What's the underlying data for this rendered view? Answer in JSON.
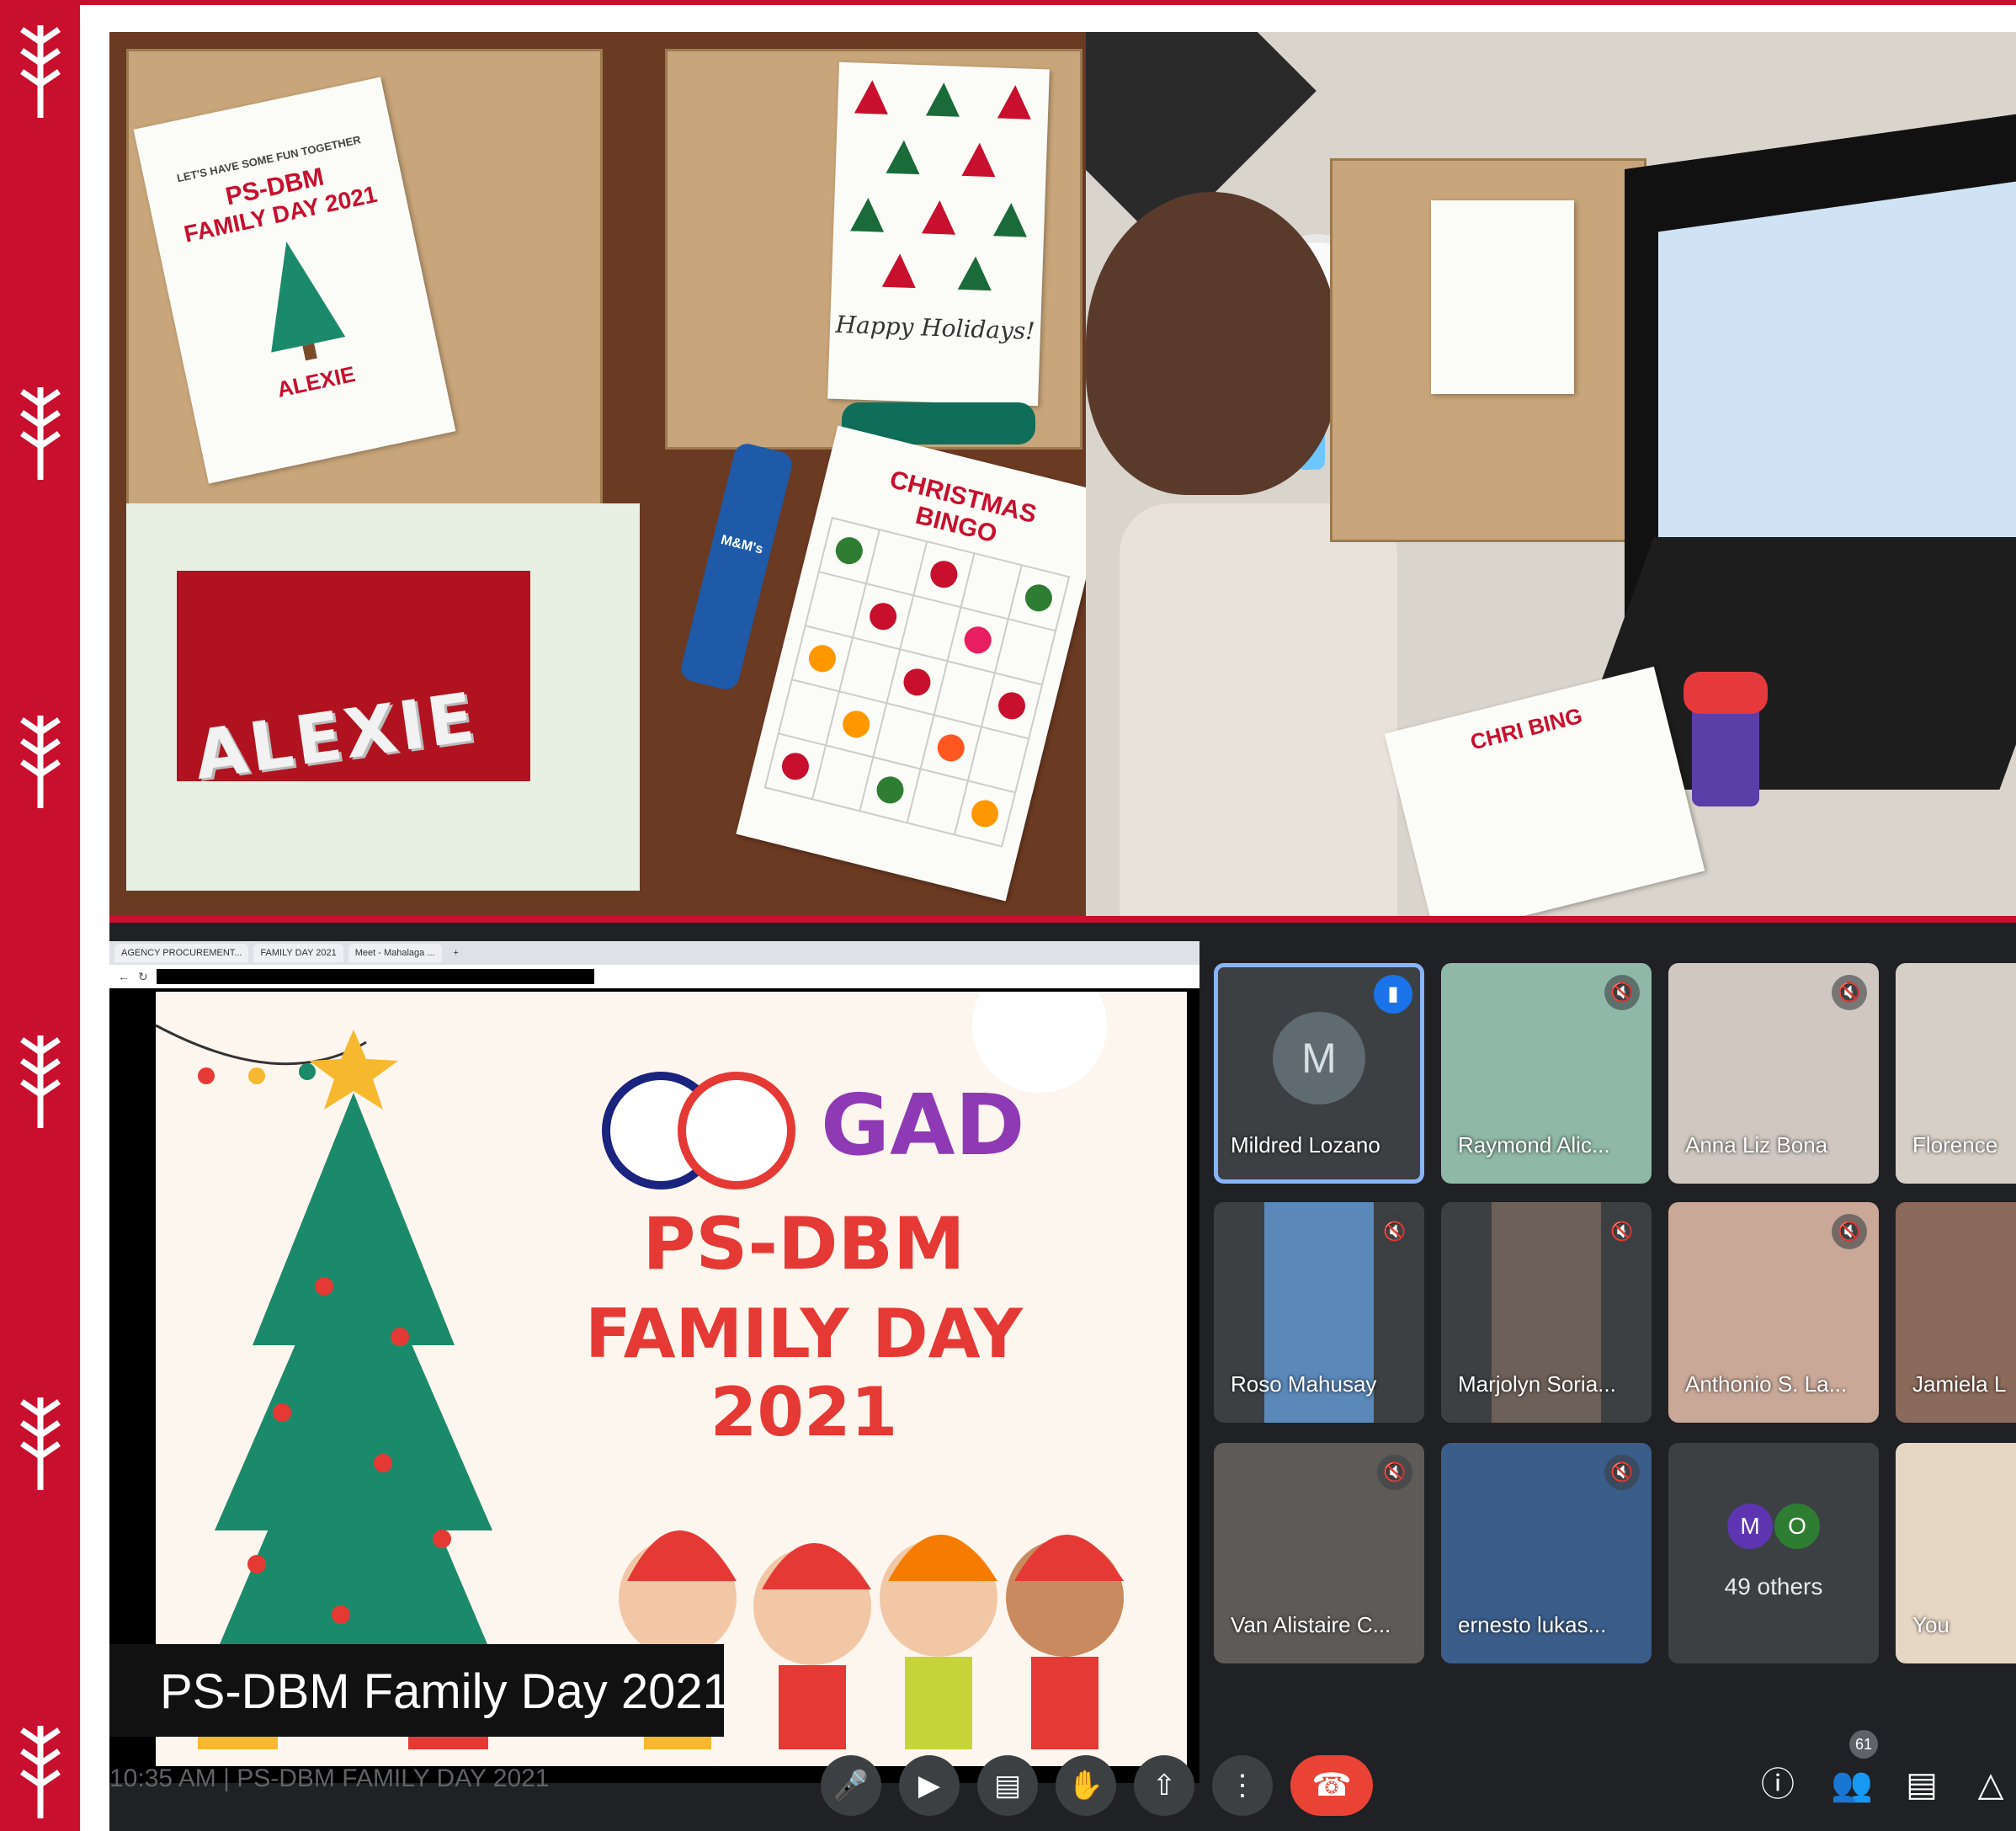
{
  "kit_photo": {
    "card_header": "LET'S HAVE SOME FUN TOGETHER",
    "card_title_1": "PS-DBM",
    "card_title_2": "FAMILY DAY 2021",
    "card_name": "ALEXIE",
    "greeting": "Happy Holidays!",
    "bingo_title_1": "CHRISTMAS",
    "bingo_title_2": "BINGO",
    "block_letters": "ALEXIE",
    "candy_label": "M&M's"
  },
  "child_photo": {
    "bingo_text": "CHRI BING"
  },
  "browser": {
    "tabs": [
      "AGENCY PROCUREMENT...",
      "FAMILY DAY 2021",
      "Meet - Mahalaga ...",
      "+"
    ]
  },
  "slide": {
    "title_1": "PS-DBM",
    "title_2": "FAMILY DAY 2021",
    "logo_gad": "GAD"
  },
  "presentation": {
    "caption": "PS-DBM Family Day 2021",
    "meeting_time": "10:35 AM",
    "meeting_name": "PS-DBM FAMILY DAY 2021"
  },
  "participants": [
    {
      "name": "Mildred Lozano",
      "initial": "M"
    },
    {
      "name": "Raymond Alic..."
    },
    {
      "name": "Anna Liz Bona"
    },
    {
      "name": "Florence"
    },
    {
      "name": "Roso Mahusay"
    },
    {
      "name": "Marjolyn Soria..."
    },
    {
      "name": "Anthonio S. La..."
    },
    {
      "name": "Jamiela L"
    },
    {
      "name": "Van Alistaire C..."
    },
    {
      "name": "ernesto lukas..."
    },
    {
      "name": "49 others",
      "initials": [
        "M",
        "O"
      ]
    },
    {
      "name": "You"
    }
  ],
  "people_count": "61",
  "colors": {
    "frame_red": "#c8102e",
    "meet_bg": "#202124",
    "tile_bg": "#3c4043",
    "end_call": "#ea4335",
    "active_speaker": "#1a73e8"
  }
}
